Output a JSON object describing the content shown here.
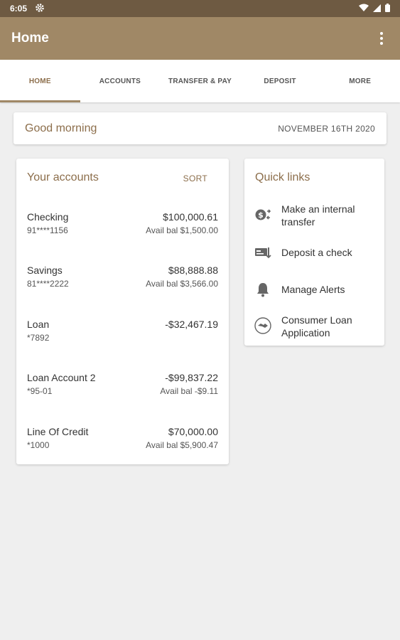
{
  "status": {
    "time": "6:05"
  },
  "appbar": {
    "title": "Home"
  },
  "tabs": [
    {
      "label": "HOME",
      "active": true
    },
    {
      "label": "ACCOUNTS"
    },
    {
      "label": "TRANSFER & PAY"
    },
    {
      "label": "DEPOSIT"
    },
    {
      "label": "MORE"
    }
  ],
  "greeting": {
    "text": "Good morning",
    "date": "NOVEMBER 16TH 2020"
  },
  "accounts": {
    "title": "Your accounts",
    "sort_label": "SORT",
    "items": [
      {
        "name": "Checking",
        "number": "91****1156",
        "balance": "$100,000.61",
        "avail": "Avail bal $1,500.00"
      },
      {
        "name": "Savings",
        "number": "81****2222",
        "balance": "$88,888.88",
        "avail": "Avail bal $3,566.00"
      },
      {
        "name": "Loan",
        "number": "*7892",
        "balance": "-$32,467.19",
        "avail": ""
      },
      {
        "name": "Loan Account 2",
        "number": "*95-01",
        "balance": "-$99,837.22",
        "avail": "Avail bal -$9.11"
      },
      {
        "name": "Line Of Credit",
        "number": "*1000",
        "balance": "$70,000.00",
        "avail": "Avail bal $5,900.47"
      }
    ]
  },
  "quick_links": {
    "title": "Quick links",
    "items": [
      {
        "label": "Make an internal transfer",
        "icon": "transfer-icon"
      },
      {
        "label": "Deposit a check",
        "icon": "check-deposit-icon"
      },
      {
        "label": "Manage Alerts",
        "icon": "bell-icon"
      },
      {
        "label": "Consumer Loan Application",
        "icon": "handshake-icon"
      }
    ]
  },
  "colors": {
    "status_bar": "#6e5a42",
    "app_bar": "#a08866",
    "accent": "#8c6e4b",
    "background": "#efefef"
  }
}
